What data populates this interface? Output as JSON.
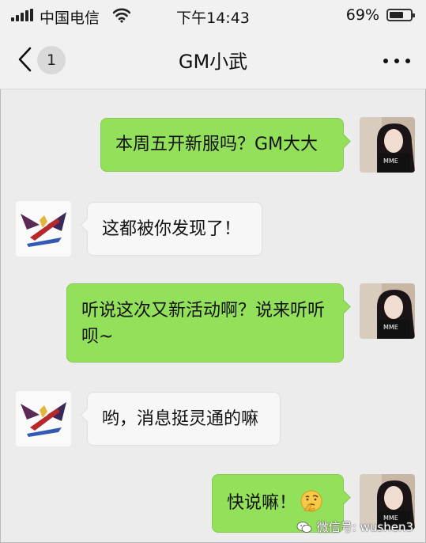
{
  "status_bar": {
    "carrier": "中国电信",
    "time": "下午14:43",
    "battery": "69%",
    "battery_level": 0.69
  },
  "nav": {
    "unread_count": "1",
    "title": "GM小武"
  },
  "messages": [
    {
      "from": "me",
      "text": "本周五开新服吗？GM大大"
    },
    {
      "from": "them",
      "text": "这都被你发现了！"
    },
    {
      "from": "me",
      "text": "听说这次又新活动啊？说来听听呗~"
    },
    {
      "from": "them",
      "text": "哟，消息挺灵通的嘛"
    },
    {
      "from": "me",
      "text": "快说嘛！",
      "emoji": "thinking-face-emoji"
    }
  ],
  "watermark": "微信号: wushen3",
  "colors": {
    "my_bubble": "#93e05a",
    "their_bubble": "#f7f7f7",
    "background": "#ececec"
  }
}
